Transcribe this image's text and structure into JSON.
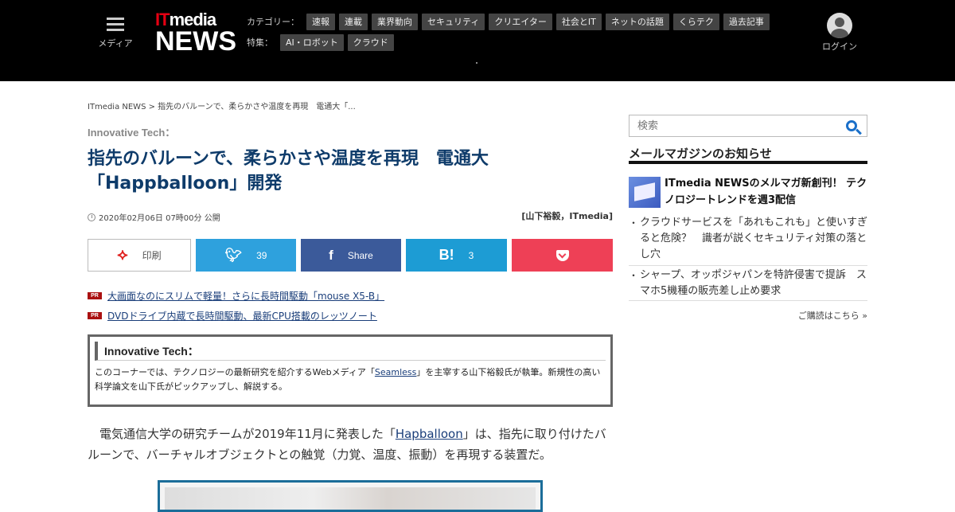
{
  "header": {
    "menu_label": "メディア",
    "logo_it": "IT",
    "logo_media": "media",
    "logo_news": "NEWS",
    "category_label": "カテゴリー：",
    "categories": [
      "速報",
      "連載",
      "業界動向",
      "セキュリティ",
      "クリエイター",
      "社会とIT",
      "ネットの話題",
      "くらテク",
      "過去記事"
    ],
    "feature_label": "特集：",
    "features": [
      "AI・ロボット",
      "クラウド"
    ],
    "login_label": "ログイン"
  },
  "breadcrumb": "ITmedia NEWS > 指先のバルーンで、柔らかさや温度を再現　電通大「...",
  "article": {
    "kicker": "Innovative Tech：",
    "title_line1": "指先のバルーンで、柔らかさや温度を再現　電通大",
    "title_line2": "「Happballoon」開発",
    "date": "2020年02月06日 07時00分 公開",
    "author": "[山下裕毅，ITmedia]",
    "share": {
      "print_label": "印刷",
      "twitter_count": "39",
      "facebook_label": "Share",
      "hatena_icon": "B!",
      "hatena_count": "3"
    },
    "pr_badge": "PR",
    "pr_links": [
      "大画面なのにスリムで軽量！さらに長時間駆動「mouse X5-B」",
      "DVDドライブ内蔵で長時間駆動、最新CPU搭載のレッツノート"
    ],
    "infobox": {
      "title": "Innovative Tech：",
      "text_before": "このコーナーでは、テクノロジーの最新研究を紹介するWebメディア「",
      "link": "Seamless",
      "text_after": "」を主宰する山下裕毅氏が執筆。新規性の高い科学論文を山下氏がピックアップし、解説する。"
    },
    "body_before": "電気通信大学の研究チームが2019年11月に発表した「",
    "body_link": "Hapballoon",
    "body_after": "」は、指先に取り付けたバルーンで、バーチャルオブジェクトとの触覚（力覚、温度、振動）を再現する装置だ。"
  },
  "sidebar": {
    "search_placeholder": "検索",
    "newsletter_heading": "メールマガジンのお知らせ",
    "feature_text": "ITmedia NEWSのメルマガ新創刊！ テクノロジートレンドを週3配信",
    "items": [
      "クラウドサービスを「あれもこれも」と使いすぎると危険？　識者が説くセキュリティ対策の落とし穴",
      "シャープ、オッポジャパンを特許侵害で提訴　スマホ5機種の販売差し止め要求"
    ],
    "more_link": "ご購読はこちら »"
  }
}
